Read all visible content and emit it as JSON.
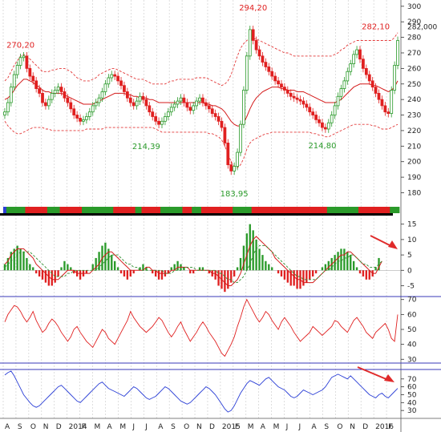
{
  "colors": {
    "bull": "#2a9a2a",
    "bear": "#e02020",
    "neutral": "#2b3fd6",
    "upper_band": "#e33a3a",
    "ma": "#d41b1b",
    "signal": "#2f8f2f",
    "rsi": "#e02020",
    "stoch": "#2b3fd6",
    "arrow": "#e02a2a",
    "last_price": "#2a9a2a",
    "grid": "#c8c8c8",
    "panel_sep": "#3a3ab8"
  },
  "chart_data": [
    {
      "type": "candlestick",
      "title": "",
      "ylim": [
        172,
        303
      ],
      "yticks": [
        180,
        190,
        200,
        210,
        220,
        230,
        240,
        250,
        260,
        270,
        280,
        290,
        300
      ],
      "x": [
        "A",
        "S",
        "O",
        "N",
        "D",
        "2014",
        "F",
        "M",
        "A",
        "M",
        "J",
        "J",
        "A",
        "S",
        "O",
        "N",
        "D",
        "2015",
        "F",
        "M",
        "A",
        "M",
        "J",
        "J",
        "A",
        "S",
        "O",
        "N",
        "D",
        "2016",
        "F"
      ],
      "close": [
        232,
        238,
        248,
        256,
        262,
        267,
        268,
        260,
        255,
        252,
        247,
        244,
        238,
        236,
        240,
        244,
        246,
        248,
        245,
        241,
        238,
        234,
        230,
        228,
        226,
        227,
        229,
        232,
        236,
        238,
        241,
        245,
        250,
        254,
        256,
        255,
        252,
        249,
        245,
        241,
        238,
        236,
        239,
        242,
        240,
        236,
        232,
        229,
        226,
        224,
        226,
        229,
        232,
        235,
        237,
        239,
        241,
        238,
        235,
        233,
        236,
        239,
        241,
        238,
        236,
        234,
        231,
        229,
        226,
        222,
        212,
        198,
        194,
        197,
        206,
        224,
        246,
        268,
        285,
        278,
        272,
        268,
        264,
        261,
        258,
        255,
        252,
        250,
        248,
        246,
        244,
        242,
        241,
        240,
        239,
        237,
        235,
        232,
        230,
        227,
        225,
        222,
        221,
        225,
        230,
        236,
        242,
        247,
        252,
        258,
        263,
        269,
        272,
        266,
        260,
        256,
        252,
        248,
        244,
        240,
        236,
        232,
        231,
        246,
        262,
        278
      ],
      "upper_band": [
        252,
        254,
        258,
        262,
        265,
        268,
        269,
        268,
        266,
        264,
        262,
        260,
        258,
        258,
        258,
        259,
        259,
        260,
        260,
        260,
        259,
        258,
        256,
        254,
        253,
        252,
        252,
        252,
        253,
        254,
        256,
        257,
        258,
        259,
        260,
        260,
        259,
        258,
        257,
        256,
        255,
        254,
        253,
        253,
        253,
        252,
        251,
        250,
        250,
        250,
        250,
        250,
        251,
        252,
        252,
        253,
        253,
        253,
        253,
        253,
        253,
        254,
        254,
        254,
        254,
        253,
        252,
        251,
        250,
        249,
        250,
        252,
        256,
        262,
        268,
        273,
        276,
        278,
        279,
        279,
        279,
        278,
        277,
        276,
        275,
        274,
        273,
        272,
        271,
        270,
        270,
        269,
        268,
        268,
        268,
        268,
        268,
        268,
        268,
        268,
        268,
        268,
        268,
        268,
        268,
        269,
        270,
        272,
        273,
        275,
        276,
        277,
        278,
        278,
        278,
        278,
        278,
        278,
        278,
        278,
        278,
        278,
        278,
        278,
        280,
        283
      ],
      "ma": [
        240,
        241,
        243,
        246,
        249,
        251,
        253,
        253,
        252,
        251,
        249,
        248,
        246,
        245,
        245,
        244,
        244,
        244,
        244,
        243,
        242,
        241,
        240,
        239,
        238,
        237,
        237,
        237,
        237,
        238,
        239,
        240,
        241,
        242,
        243,
        244,
        244,
        244,
        244,
        243,
        243,
        242,
        242,
        241,
        241,
        241,
        240,
        240,
        239,
        238,
        238,
        238,
        238,
        238,
        238,
        238,
        238,
        238,
        238,
        238,
        238,
        238,
        238,
        238,
        237,
        237,
        236,
        236,
        235,
        234,
        232,
        229,
        226,
        224,
        223,
        223,
        225,
        229,
        234,
        238,
        241,
        243,
        245,
        246,
        247,
        248,
        248,
        248,
        247,
        247,
        246,
        246,
        246,
        245,
        245,
        245,
        244,
        243,
        242,
        241,
        240,
        239,
        238,
        238,
        238,
        238,
        239,
        240,
        242,
        244,
        246,
        248,
        249,
        250,
        250,
        250,
        250,
        249,
        249,
        248,
        247,
        246,
        245,
        246,
        248,
        252
      ],
      "lower_band": [
        226,
        223,
        221,
        219,
        218,
        218,
        219,
        220,
        221,
        222,
        222,
        222,
        222,
        221,
        221,
        220,
        220,
        220,
        220,
        220,
        220,
        220,
        220,
        220,
        220,
        220,
        221,
        221,
        221,
        221,
        221,
        221,
        222,
        222,
        222,
        222,
        222,
        222,
        222,
        222,
        222,
        222,
        222,
        222,
        222,
        222,
        222,
        222,
        221,
        220,
        219,
        219,
        219,
        219,
        219,
        219,
        219,
        219,
        219,
        219,
        219,
        219,
        219,
        219,
        219,
        218,
        218,
        217,
        216,
        214,
        210,
        205,
        200,
        197,
        196,
        198,
        202,
        208,
        212,
        214,
        215,
        216,
        217,
        218,
        218,
        219,
        219,
        219,
        219,
        219,
        219,
        219,
        219,
        219,
        219,
        219,
        219,
        219,
        218,
        218,
        217,
        217,
        216,
        216,
        217,
        218,
        219,
        220,
        221,
        222,
        223,
        224,
        224,
        224,
        224,
        224,
        224,
        223,
        223,
        222,
        221,
        221,
        221,
        222,
        223,
        224
      ],
      "annotations": [
        {
          "text": "270,20",
          "color": "#e02020",
          "at_index": 5,
          "value": 270.2
        },
        {
          "text": "214,39",
          "color": "#2a9a2a",
          "at_index": 45,
          "value": 214.39
        },
        {
          "text": "183,95",
          "color": "#2a9a2a",
          "at_index": 73,
          "value": 183.95
        },
        {
          "text": "294,20",
          "color": "#e02020",
          "at_index": 79,
          "value": 294.2
        },
        {
          "text": "214,80",
          "color": "#2a9a2a",
          "at_index": 101,
          "value": 214.8
        },
        {
          "text": "282,10",
          "color": "#e02020",
          "at_index": 118,
          "value": 282.1
        }
      ],
      "last_price": "282,000"
    },
    {
      "type": "histogram+line",
      "ylim": [
        -8,
        17
      ],
      "yticks": [
        -5,
        0,
        5,
        10,
        15
      ],
      "hist": [
        2,
        4,
        6,
        7,
        8,
        7,
        6,
        4,
        2,
        1,
        -1,
        -2,
        -3,
        -4,
        -5,
        -5,
        -4,
        -2,
        1,
        3,
        2,
        1,
        -1,
        -2,
        -3,
        -2,
        -1,
        0,
        2,
        4,
        6,
        8,
        9,
        7,
        5,
        3,
        1,
        -1,
        -2,
        -3,
        -2,
        -1,
        0,
        1,
        2,
        1,
        0,
        -1,
        -2,
        -3,
        -3,
        -2,
        -1,
        1,
        2,
        3,
        2,
        1,
        0,
        -1,
        -1,
        0,
        1,
        1,
        0,
        -1,
        -2,
        -3,
        -5,
        -6,
        -7,
        -6,
        -4,
        -2,
        1,
        4,
        8,
        12,
        15,
        13,
        10,
        7,
        5,
        3,
        2,
        1,
        0,
        -1,
        -2,
        -3,
        -4,
        -5,
        -5,
        -6,
        -6,
        -5,
        -4,
        -3,
        -2,
        -1,
        0,
        1,
        2,
        3,
        4,
        5,
        6,
        7,
        7,
        6,
        5,
        3,
        1,
        -1,
        -2,
        -3,
        -3,
        -2,
        1,
        4
      ],
      "line": [
        2,
        3,
        5,
        6,
        7,
        7,
        7,
        6,
        5,
        4,
        2,
        1,
        0,
        -1,
        -2,
        -3,
        -3,
        -3,
        -2,
        -1,
        0,
        0,
        0,
        -1,
        -1,
        -1,
        -1,
        -1,
        0,
        1,
        2,
        4,
        5,
        6,
        6,
        5,
        4,
        3,
        2,
        1,
        0,
        0,
        0,
        0,
        0,
        1,
        1,
        0,
        0,
        -1,
        -1,
        -1,
        -1,
        0,
        0,
        1,
        1,
        1,
        1,
        0,
        0,
        0,
        0,
        0,
        0,
        0,
        -1,
        -1,
        -2,
        -3,
        -4,
        -5,
        -5,
        -4,
        -3,
        -1,
        2,
        5,
        8,
        10,
        11,
        10,
        9,
        8,
        7,
        6,
        4,
        3,
        2,
        1,
        0,
        -1,
        -2,
        -3,
        -3,
        -4,
        -4,
        -4,
        -4,
        -3,
        -2,
        -1,
        0,
        1,
        2,
        3,
        4,
        5,
        5,
        6,
        6,
        5,
        4,
        3,
        2,
        1,
        0,
        -1,
        -1,
        1,
        3
      ],
      "signal": [
        1,
        2,
        3,
        4,
        5,
        6,
        6,
        6,
        6,
        5,
        4,
        3,
        2,
        1,
        0,
        -1,
        -2,
        -2,
        -2,
        -2,
        -1,
        -1,
        0,
        0,
        0,
        0,
        0,
        0,
        0,
        0,
        1,
        2,
        3,
        4,
        5,
        5,
        5,
        4,
        3,
        2,
        2,
        1,
        1,
        0,
        0,
        0,
        0,
        0,
        0,
        0,
        0,
        -1,
        -1,
        -1,
        0,
        0,
        0,
        1,
        1,
        1,
        1,
        0,
        0,
        0,
        0,
        0,
        0,
        0,
        -1,
        -1,
        -2,
        -3,
        -3,
        -4,
        -4,
        -3,
        -2,
        0,
        2,
        5,
        7,
        8,
        8,
        8,
        7,
        6,
        5,
        4,
        3,
        2,
        1,
        0,
        -1,
        -2,
        -2,
        -3,
        -3,
        -3,
        -3,
        -3,
        -2,
        -1,
        0,
        0,
        1,
        2,
        3,
        3,
        4,
        4,
        5,
        5,
        4,
        3,
        2,
        2,
        1,
        1,
        1,
        2,
        3
      ],
      "arrow_label": ""
    },
    {
      "type": "line",
      "ylim": [
        28,
        72
      ],
      "yticks": [
        30,
        40,
        50,
        60,
        70
      ],
      "values": [
        55,
        60,
        63,
        66,
        65,
        62,
        58,
        55,
        58,
        62,
        56,
        52,
        48,
        50,
        54,
        57,
        55,
        52,
        48,
        45,
        42,
        45,
        50,
        52,
        48,
        45,
        42,
        40,
        38,
        42,
        46,
        50,
        48,
        44,
        42,
        40,
        44,
        48,
        52,
        56,
        62,
        58,
        55,
        52,
        50,
        48,
        50,
        52,
        55,
        58,
        56,
        52,
        48,
        45,
        48,
        52,
        55,
        50,
        46,
        42,
        45,
        48,
        52,
        55,
        52,
        48,
        45,
        42,
        38,
        34,
        32,
        36,
        40,
        45,
        52,
        58,
        65,
        70,
        66,
        62,
        58,
        55,
        58,
        62,
        60,
        56,
        53,
        50,
        55,
        58,
        55,
        52,
        48,
        45,
        42,
        44,
        46,
        48,
        52,
        50,
        48,
        46,
        48,
        50,
        52,
        56,
        55,
        52,
        50,
        48,
        52,
        56,
        58,
        55,
        52,
        48,
        46,
        44,
        48,
        50,
        52,
        54,
        50,
        44,
        42,
        60
      ]
    },
    {
      "type": "line",
      "ylim": [
        20,
        82
      ],
      "yticks": [
        30,
        40,
        50,
        60,
        70
      ],
      "values": [
        75,
        78,
        80,
        74,
        66,
        58,
        50,
        45,
        40,
        36,
        34,
        36,
        40,
        44,
        48,
        52,
        56,
        60,
        62,
        58,
        54,
        50,
        46,
        42,
        40,
        44,
        48,
        52,
        56,
        60,
        64,
        66,
        62,
        58,
        56,
        54,
        52,
        50,
        48,
        52,
        56,
        60,
        58,
        54,
        50,
        46,
        44,
        46,
        48,
        52,
        56,
        60,
        58,
        54,
        50,
        46,
        42,
        40,
        38,
        40,
        44,
        48,
        52,
        56,
        60,
        58,
        54,
        50,
        44,
        38,
        32,
        28,
        30,
        36,
        44,
        52,
        58,
        64,
        68,
        66,
        64,
        62,
        66,
        70,
        72,
        68,
        64,
        60,
        58,
        56,
        52,
        48,
        46,
        48,
        52,
        56,
        54,
        52,
        50,
        52,
        54,
        56,
        60,
        66,
        72,
        74,
        76,
        74,
        72,
        70,
        74,
        70,
        66,
        62,
        58,
        54,
        50,
        48,
        46,
        50,
        52,
        48,
        46,
        50,
        54,
        58
      ],
      "arrow_label": ""
    }
  ]
}
